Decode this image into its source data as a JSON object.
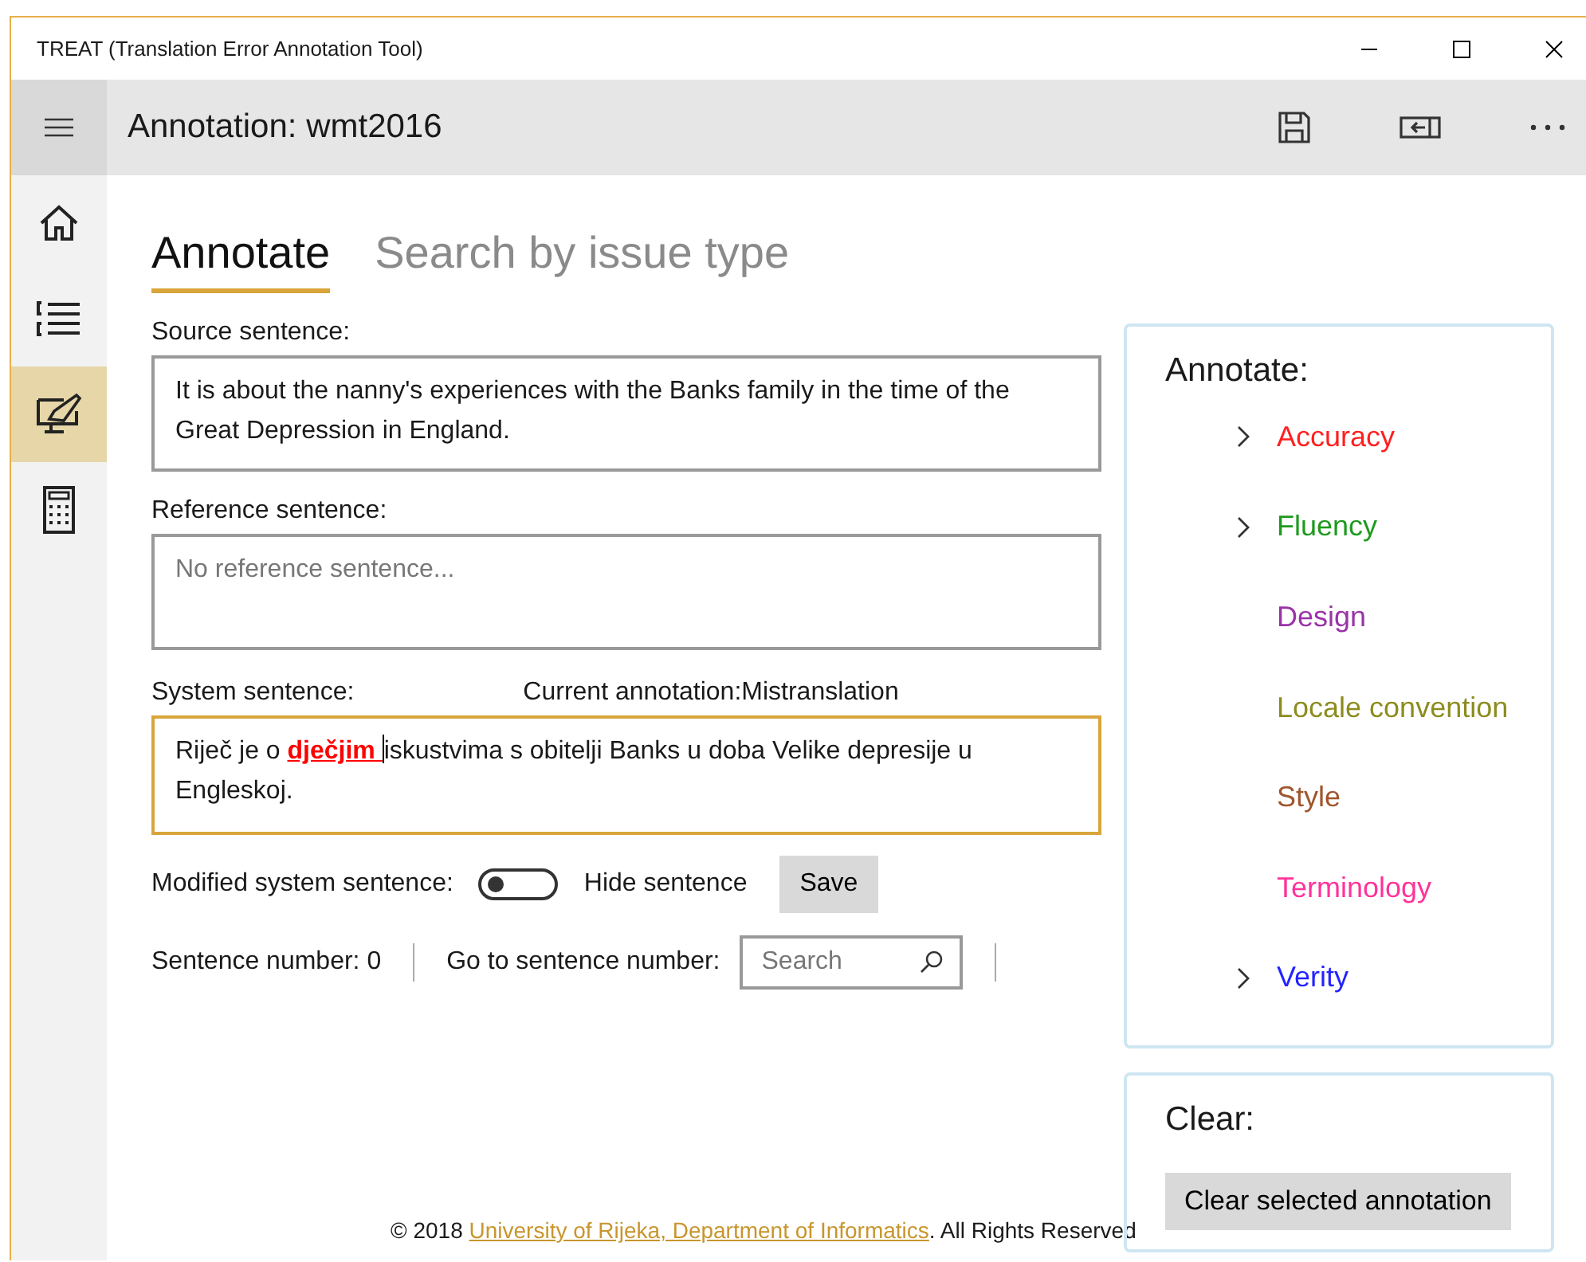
{
  "window": {
    "title": "TREAT (Translation Error Annotation Tool)"
  },
  "header": {
    "title": "Annotation: wmt2016"
  },
  "rail": [
    {
      "kind": "home",
      "selected": false
    },
    {
      "kind": "list",
      "selected": false
    },
    {
      "kind": "annotate",
      "selected": true
    },
    {
      "kind": "calculator",
      "selected": false
    }
  ],
  "tabs": [
    {
      "label": "Annotate",
      "selected": true
    },
    {
      "label": "Search by issue type",
      "selected": false
    }
  ],
  "source": {
    "label": "Source sentence:",
    "value": "It is about the nanny's experiences with the Banks family in the time of the Great Depression in England."
  },
  "reference": {
    "label": "Reference sentence:",
    "placeholder": "No reference sentence..."
  },
  "system": {
    "label": "System sentence:",
    "current_annotation": "Current annotation:Mistranslation",
    "segments": [
      {
        "text": "Riječ je o ",
        "highlighted": false
      },
      {
        "text": "dječjim ",
        "highlighted": true,
        "color": "#ff0000"
      },
      {
        "text": "iskustvima s obitelji Banks u doba Velike depresije u Engleskoj.",
        "highlighted": false
      }
    ]
  },
  "modified": {
    "label": "Modified system sentence:",
    "on": false
  },
  "hide_label": "Hide sentence",
  "save_button": "Save",
  "sentence_number": "Sentence number: 0",
  "goto": {
    "label": "Go to sentence number:",
    "placeholder": "Search"
  },
  "annotate_panel": {
    "title": "Annotate:",
    "items": [
      {
        "label": "Accuracy",
        "color": "#ff1f1f",
        "kind": "group",
        "expanded": false
      },
      {
        "label": "Fluency",
        "color": "#1e9a1e",
        "kind": "group",
        "expanded": false
      },
      {
        "label": "Design",
        "color": "#9a33a8",
        "kind": "leaf"
      },
      {
        "label": "Locale convention",
        "color": "#8c8c1e",
        "kind": "leaf"
      },
      {
        "label": "Style",
        "color": "#a0552d",
        "kind": "leaf"
      },
      {
        "label": "Terminology",
        "color": "#ff3399",
        "kind": "leaf"
      },
      {
        "label": "Verity",
        "color": "#2323ff",
        "kind": "group",
        "expanded": false
      }
    ]
  },
  "clear_panel": {
    "title": "Clear:",
    "button": "Clear selected annotation"
  },
  "footer": {
    "prefix": "© 2018 ",
    "link": "University of Rijeka, Department of Informatics",
    "suffix": ". All Rights Reserved"
  }
}
